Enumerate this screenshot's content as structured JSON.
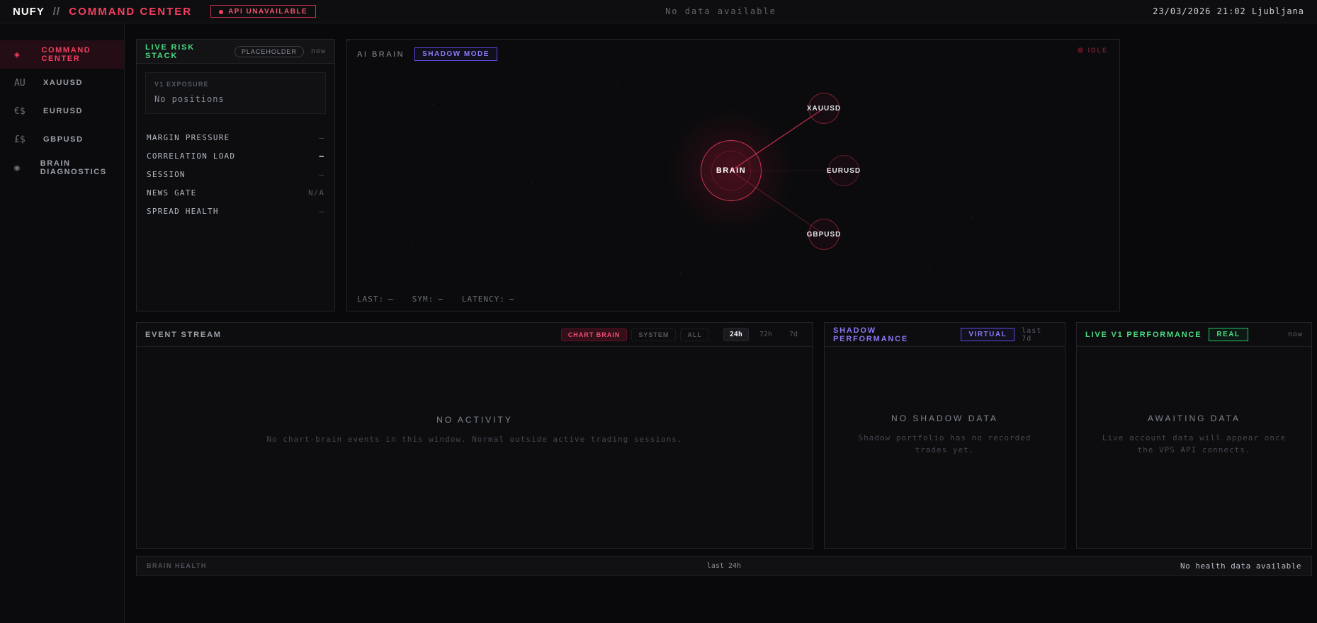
{
  "header": {
    "brand": "NUFY",
    "brand_sep": "//",
    "brand_section": "COMMAND CENTER",
    "api_badge": "API UNAVAILABLE",
    "status_text": "No data available",
    "clock": "23/03/2026 21:02 Ljubljana"
  },
  "sidebar": {
    "items": [
      {
        "icon": "◈",
        "label": "COMMAND CENTER"
      },
      {
        "icon": "AU",
        "label": "XAUUSD"
      },
      {
        "icon": "€$",
        "label": "EURUSD"
      },
      {
        "icon": "£$",
        "label": "GBPUSD"
      },
      {
        "icon": "◉",
        "label": "BRAIN DIAGNOSTICS"
      }
    ]
  },
  "risk_stack": {
    "title": "LIVE RISK STACK",
    "badge": "PLACEHOLDER",
    "timeframe": "now",
    "exposure_label": "V1 EXPOSURE",
    "exposure_value": "No positions",
    "rows": [
      {
        "label": "MARGIN PRESSURE",
        "value": "—"
      },
      {
        "label": "CORRELATION LOAD",
        "value": "—"
      },
      {
        "label": "SESSION",
        "value": "—"
      },
      {
        "label": "NEWS GATE",
        "value": "N/A"
      },
      {
        "label": "SPREAD HEALTH",
        "value": "—"
      }
    ]
  },
  "brain": {
    "title": "AI BRAIN",
    "mode_badge": "SHADOW MODE",
    "status": "IDLE",
    "center_label": "BRAIN",
    "nodes": [
      {
        "label": "XAUUSD"
      },
      {
        "label": "EURUSD"
      },
      {
        "label": "GBPUSD"
      }
    ],
    "footer": {
      "last_label": "LAST:",
      "last_value": "—",
      "sym_label": "SYM:",
      "sym_value": "—",
      "latency_label": "LATENCY:",
      "latency_value": "—"
    },
    "colors": {
      "accent": "#f43f5e"
    }
  },
  "event_stream": {
    "title": "EVENT STREAM",
    "filters": [
      {
        "label": "CHART BRAIN"
      },
      {
        "label": "SYSTEM"
      },
      {
        "label": "ALL"
      }
    ],
    "ranges": [
      {
        "label": "24h"
      },
      {
        "label": "72h"
      },
      {
        "label": "7d"
      }
    ],
    "empty_title": "NO ACTIVITY",
    "empty_message": "No chart-brain events in this window. Normal outside active trading sessions."
  },
  "shadow_performance": {
    "title": "SHADOW PERFORMANCE",
    "badge": "VIRTUAL",
    "timeframe": "last 7d",
    "empty_title": "NO SHADOW DATA",
    "empty_message": "Shadow portfolio has no recorded trades yet."
  },
  "live_performance": {
    "title": "LIVE V1 PERFORMANCE",
    "badge": "REAL",
    "timeframe": "now",
    "empty_title": "AWAITING DATA",
    "empty_message": "Live account data will appear once the VPS API connects."
  },
  "brain_health": {
    "title": "BRAIN HEALTH",
    "timeframe": "last 24h",
    "status": "No health data available"
  }
}
